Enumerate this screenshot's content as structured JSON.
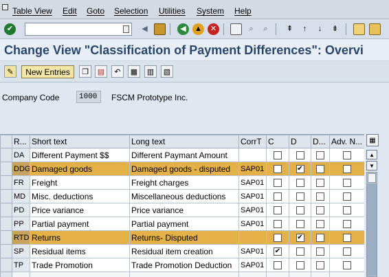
{
  "menu": [
    "Table View",
    "Edit",
    "Goto",
    "Selection",
    "Utilities",
    "System",
    "Help"
  ],
  "toolbar": {
    "command_value": ""
  },
  "title": "Change View \"Classification of Payment Differences\": Overvi",
  "app_toolbar": {
    "new_entries_label": "New Entries"
  },
  "company": {
    "label": "Company Code",
    "code": "1000",
    "name": "FSCM Prototype Inc."
  },
  "table": {
    "columns": [
      "R...",
      "Short text",
      "Long text",
      "CorrT",
      "C",
      "D",
      "D...",
      "Adv. N..."
    ],
    "rows": [
      {
        "r": "DA",
        "short": "Different Payment $$",
        "long": "Different Paymant Amount",
        "corr": "",
        "c": false,
        "d": false,
        "d2": false,
        "adv": false,
        "highlight": false
      },
      {
        "r": "DDG",
        "short": "Damaged goods",
        "long": "Damaged goods - disputed",
        "corr": "SAP01",
        "c": false,
        "d": true,
        "d2": false,
        "adv": false,
        "highlight": true
      },
      {
        "r": "FR",
        "short": "Freight",
        "long": "Freight charges",
        "corr": "SAP01",
        "c": false,
        "d": false,
        "d2": false,
        "adv": false,
        "highlight": false
      },
      {
        "r": "MD",
        "short": "Misc. deductions",
        "long": "Miscellaneous deductions",
        "corr": "SAP01",
        "c": false,
        "d": false,
        "d2": false,
        "adv": false,
        "highlight": false
      },
      {
        "r": "PD",
        "short": "Price variance",
        "long": "Price variance",
        "corr": "SAP01",
        "c": false,
        "d": false,
        "d2": false,
        "adv": false,
        "highlight": false
      },
      {
        "r": "PP",
        "short": "Partial payment",
        "long": "Partial payment",
        "corr": "SAP01",
        "c": false,
        "d": false,
        "d2": false,
        "adv": false,
        "highlight": false
      },
      {
        "r": "RTD",
        "short": "Returns",
        "long": "Returns- Disputed",
        "corr": "",
        "c": false,
        "d": true,
        "d2": false,
        "adv": false,
        "highlight": true
      },
      {
        "r": "SP",
        "short": "Residual items",
        "long": "Residual item creation",
        "corr": "SAP01",
        "c": true,
        "d": false,
        "d2": false,
        "adv": false,
        "highlight": false
      },
      {
        "r": "TP",
        "short": "Trade Promotion",
        "long": "Trade Promotion Deduction",
        "corr": "SAP01",
        "c": false,
        "d": false,
        "d2": false,
        "adv": false,
        "highlight": false
      }
    ]
  },
  "colors": {
    "highlight_row": "#e4b048",
    "title_text": "#29466e",
    "new_entries_bg": "#f4e6a7"
  }
}
